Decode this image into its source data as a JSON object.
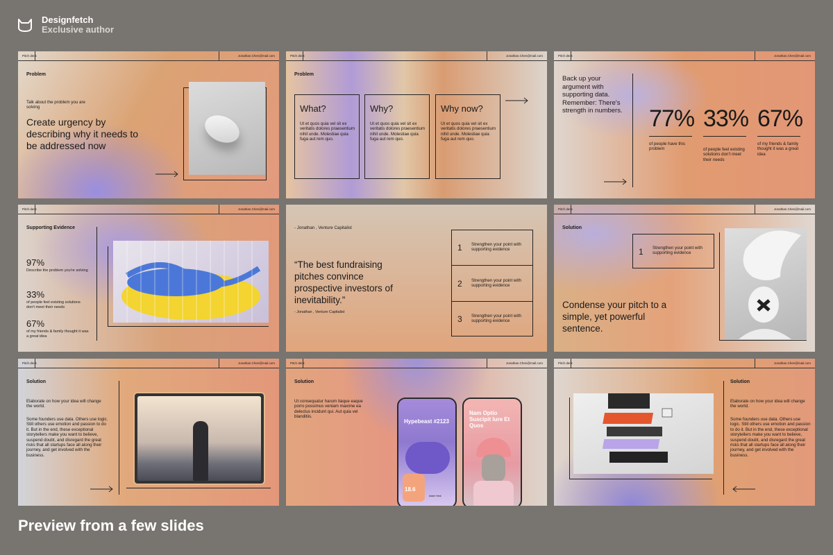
{
  "brand": {
    "name": "Designfetch",
    "subtitle": "Exclusive author"
  },
  "footer": {
    "title": "Preview from a few slides"
  },
  "header": {
    "left": "Pitch deck",
    "right": "Jonathan.Chen@mail.com"
  },
  "slides": {
    "s1": {
      "label": "Problem",
      "small": "Talk about the problem you are solving",
      "big": "Create urgency by describing why it needs to be addressed now"
    },
    "s2": {
      "label": "Problem",
      "cols": [
        {
          "title": "What?",
          "body": "Ut et quos quia vel sit ex veritatis dolores praesentium nihil unde. Molestiae quia fuga aut rem quo."
        },
        {
          "title": "Why?",
          "body": "Ut et quos quia vel sit ex veritatis dolores praesentium nihil unde. Molestiae quia fuga aut rem quo."
        },
        {
          "title": "Why now?",
          "body": "Ut et quos quia vel sit ex veritatis dolores praesentium nihil unde. Molestiae quia fuga aut rem quo."
        }
      ]
    },
    "s3": {
      "intro": "Back up your argument with supporting data. Remember: There's strength in numbers.",
      "stats": [
        {
          "value": "77%",
          "caption": "of people have this problem"
        },
        {
          "value": "33%",
          "caption": "of people feel existing solutions don't meet their needs"
        },
        {
          "value": "67%",
          "caption": "of my friends & family thought it was a great idea"
        }
      ]
    },
    "s4": {
      "label": "Supporting Evidence",
      "stats": [
        {
          "value": "97%",
          "caption": "Describe the problem you're solving"
        },
        {
          "value": "33%",
          "caption": "of people feel existing solutions don't meet their needs"
        },
        {
          "value": "67%",
          "caption": "of my friends & family thought it was a great idea"
        }
      ]
    },
    "s5": {
      "attribution_top": "- Jonathan , Venture Capitalist",
      "quote": "“The best fundraising pitches convince prospective investors of inevitability.”",
      "attribution": "- Jonathan , Venture Capitalist",
      "points": [
        {
          "n": "1",
          "text": "Strengthen your point with supporting evidence"
        },
        {
          "n": "2",
          "text": "Strengthen your point with supporting evidence"
        },
        {
          "n": "3",
          "text": "Strengthen your point with supporting evidence"
        }
      ]
    },
    "s6": {
      "label": "Solution",
      "point": {
        "n": "1",
        "text": "Strengthen your point with supporting evidence"
      },
      "big": "Condense your pitch to a simple, yet powerful sentence."
    },
    "s7": {
      "label": "Solution",
      "lead": "Elaborate on how your idea will change the world.",
      "body": "Some founders use data. Others use logic. Still others use emotion and passion to do it. But in the end, these exceptional storytellers make you want to believe, suspend doubt, and disregard the great risks that all startups face all along their journey, and get involved with the business."
    },
    "s8": {
      "label": "Solution",
      "body": "Ut consequatur harum itaque eaque porro possimus veniam maxime ea delectus incidunt qui. Aut quia vel blanditiis.",
      "phone1": {
        "title": "Hypebeast #2123",
        "stat": "18.6",
        "user": "Adam Heat"
      },
      "phone2": {
        "title": "Nam Optio Suscipit Iure Et Quos"
      }
    },
    "s9": {
      "label": "Solution",
      "lead": "Elaborate on how your idea will change the world.",
      "body": "Some founders use data. Others use logic. Still others use emotion and passion to do it. But in the end, these exceptional storytellers make you want to believe, suspend doubt, and disregard the great risks that all startups face all along their journey, and get involved with the business."
    }
  },
  "colors": {
    "background": "#787470",
    "ink": "#1a1a1a",
    "orange": "#e4572e",
    "purple": "#a58bd9"
  }
}
